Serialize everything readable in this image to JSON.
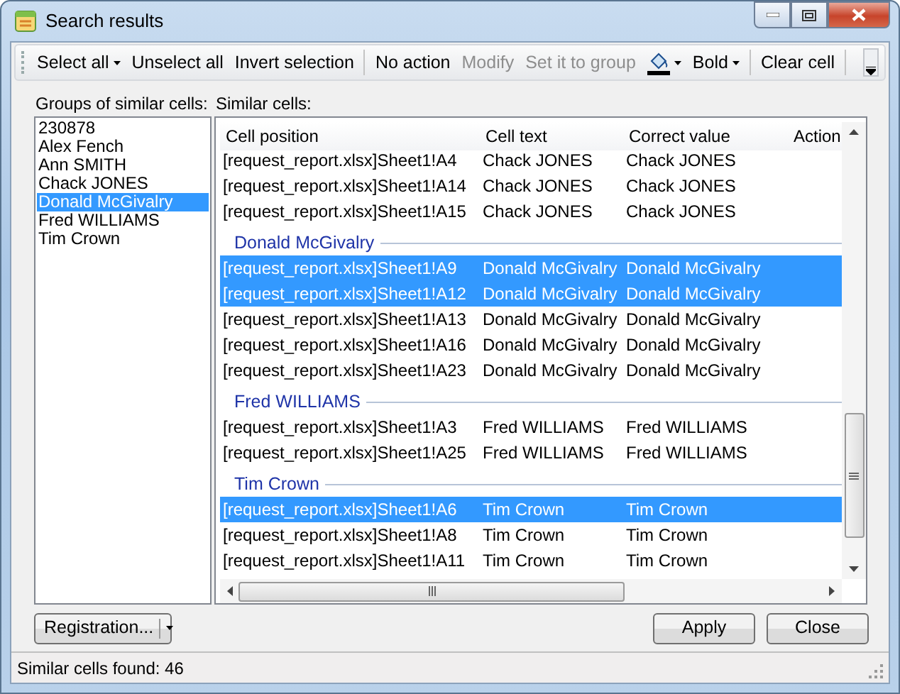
{
  "window": {
    "title": "Search results"
  },
  "toolbar": [
    {
      "kind": "button",
      "label": "Select all",
      "disabled": false,
      "dropdown": true
    },
    {
      "kind": "button",
      "label": "Unselect all",
      "disabled": false,
      "dropdown": false
    },
    {
      "kind": "button",
      "label": "Invert selection",
      "disabled": false,
      "dropdown": false
    },
    {
      "kind": "separator"
    },
    {
      "kind": "button",
      "label": "No action",
      "disabled": false,
      "dropdown": false
    },
    {
      "kind": "button",
      "label": "Modify",
      "disabled": true,
      "dropdown": false
    },
    {
      "kind": "button",
      "label": "Set it to group",
      "disabled": true,
      "dropdown": false
    },
    {
      "kind": "fill",
      "dropdown": true
    },
    {
      "kind": "button",
      "label": "Bold",
      "disabled": false,
      "dropdown": true
    },
    {
      "kind": "separator"
    },
    {
      "kind": "button",
      "label": "Clear cell",
      "disabled": false,
      "dropdown": false
    },
    {
      "kind": "separator"
    }
  ],
  "groups_label": "Groups of similar cells:",
  "groups": [
    {
      "label": "230878",
      "selected": false
    },
    {
      "label": "Alex Fench",
      "selected": false
    },
    {
      "label": "Ann SMITH",
      "selected": false
    },
    {
      "label": "Chack JONES",
      "selected": false
    },
    {
      "label": "Donald McGivalry",
      "selected": true
    },
    {
      "label": "Fred WILLIAMS",
      "selected": false
    },
    {
      "label": "Tim Crown",
      "selected": false
    }
  ],
  "cells_label": "Similar cells:",
  "table": {
    "columns": [
      "Cell position",
      "Cell text",
      "Correct value",
      "Action"
    ],
    "rows": [
      {
        "kind": "row",
        "cells": [
          "[request_report.xlsx]Sheet1!A4",
          "Chack JONES",
          "Chack JONES"
        ],
        "selected": false
      },
      {
        "kind": "row",
        "cells": [
          "[request_report.xlsx]Sheet1!A14",
          "Chack JONES",
          "Chack JONES"
        ],
        "selected": false
      },
      {
        "kind": "row",
        "cells": [
          "[request_report.xlsx]Sheet1!A15",
          "Chack JONES",
          "Chack JONES"
        ],
        "selected": false
      },
      {
        "kind": "group",
        "label": "Donald McGivalry"
      },
      {
        "kind": "row",
        "cells": [
          "[request_report.xlsx]Sheet1!A9",
          "Donald McGivalry",
          "Donald McGivalry"
        ],
        "selected": true
      },
      {
        "kind": "row",
        "cells": [
          "[request_report.xlsx]Sheet1!A12",
          "Donald McGivalry",
          "Donald McGivalry"
        ],
        "selected": true
      },
      {
        "kind": "row",
        "cells": [
          "[request_report.xlsx]Sheet1!A13",
          "Donald McGivalry",
          "Donald McGivalry"
        ],
        "selected": false
      },
      {
        "kind": "row",
        "cells": [
          "[request_report.xlsx]Sheet1!A16",
          "Donald McGivalry",
          "Donald McGivalry"
        ],
        "selected": false
      },
      {
        "kind": "row",
        "cells": [
          "[request_report.xlsx]Sheet1!A23",
          "Donald McGivalry",
          "Donald McGivalry"
        ],
        "selected": false
      },
      {
        "kind": "group",
        "label": "Fred WILLIAMS"
      },
      {
        "kind": "row",
        "cells": [
          "[request_report.xlsx]Sheet1!A3",
          "Fred WILLIAMS",
          "Fred WILLIAMS"
        ],
        "selected": false
      },
      {
        "kind": "row",
        "cells": [
          "[request_report.xlsx]Sheet1!A25",
          "Fred WILLIAMS",
          "Fred WILLIAMS"
        ],
        "selected": false
      },
      {
        "kind": "group",
        "label": "Tim Crown"
      },
      {
        "kind": "row",
        "cells": [
          "[request_report.xlsx]Sheet1!A6",
          "Tim Crown",
          "Tim Crown"
        ],
        "selected": true
      },
      {
        "kind": "row",
        "cells": [
          "[request_report.xlsx]Sheet1!A8",
          "Tim Crown",
          "Tim Crown"
        ],
        "selected": false
      },
      {
        "kind": "row",
        "cells": [
          "[request_report.xlsx]Sheet1!A11",
          "Tim Crown",
          "Tim Crown"
        ],
        "selected": false
      }
    ]
  },
  "registration_button": {
    "label": "Registration...",
    "dropdown": true
  },
  "buttons": [
    "Apply",
    "Close"
  ],
  "status_bar": "Similar cells found: 46"
}
